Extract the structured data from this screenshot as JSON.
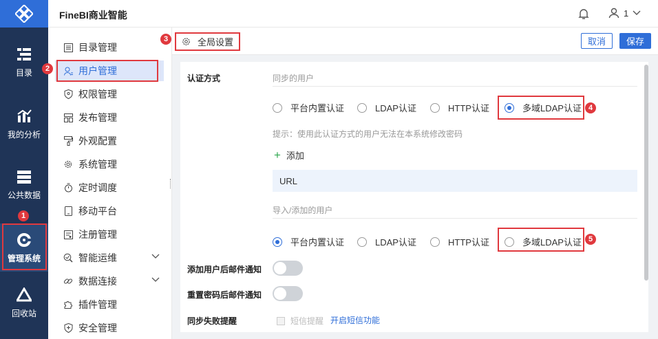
{
  "header": {
    "brand": "FineBI商业智能",
    "user": "1"
  },
  "leftnav": [
    {
      "label": "目录",
      "icon": "catalog-icon"
    },
    {
      "label": "我的分析",
      "icon": "chart-icon"
    },
    {
      "label": "公共数据",
      "icon": "database-icon"
    },
    {
      "label": "管理系统",
      "icon": "settings-gear-icon"
    },
    {
      "label": "回收站",
      "icon": "recycle-icon"
    }
  ],
  "submenu": [
    {
      "label": "目录管理"
    },
    {
      "label": "用户管理"
    },
    {
      "label": "权限管理"
    },
    {
      "label": "发布管理"
    },
    {
      "label": "外观配置"
    },
    {
      "label": "系统管理"
    },
    {
      "label": "定时调度"
    },
    {
      "label": "移动平台"
    },
    {
      "label": "注册管理"
    },
    {
      "label": "智能运维"
    },
    {
      "label": "数据连接"
    },
    {
      "label": "插件管理"
    },
    {
      "label": "安全管理"
    }
  ],
  "toolbar": {
    "tab": "全局设置",
    "cancel": "取消",
    "save": "保存"
  },
  "form": {
    "auth_label": "认证方式",
    "sync_title": "同步的用户",
    "sync_options": [
      "平台内置认证",
      "LDAP认证",
      "HTTP认证",
      "多域LDAP认证"
    ],
    "hint": "提示：使用此认证方式的用户无法在本系统修改密码",
    "add": "添加",
    "url": "URL",
    "import_title": "导入/添加的用户",
    "import_options": [
      "平台内置认证",
      "LDAP认证",
      "HTTP认证",
      "多域LDAP认证"
    ],
    "mail_after_add": "添加用户后邮件通知",
    "mail_after_reset": "重置密码后邮件通知",
    "sync_fail": "同步失败提醒",
    "sms_checkbox": "短信提醒",
    "sms_link": "开启短信功能"
  },
  "badges": [
    "1",
    "2",
    "3",
    "4",
    "5"
  ]
}
